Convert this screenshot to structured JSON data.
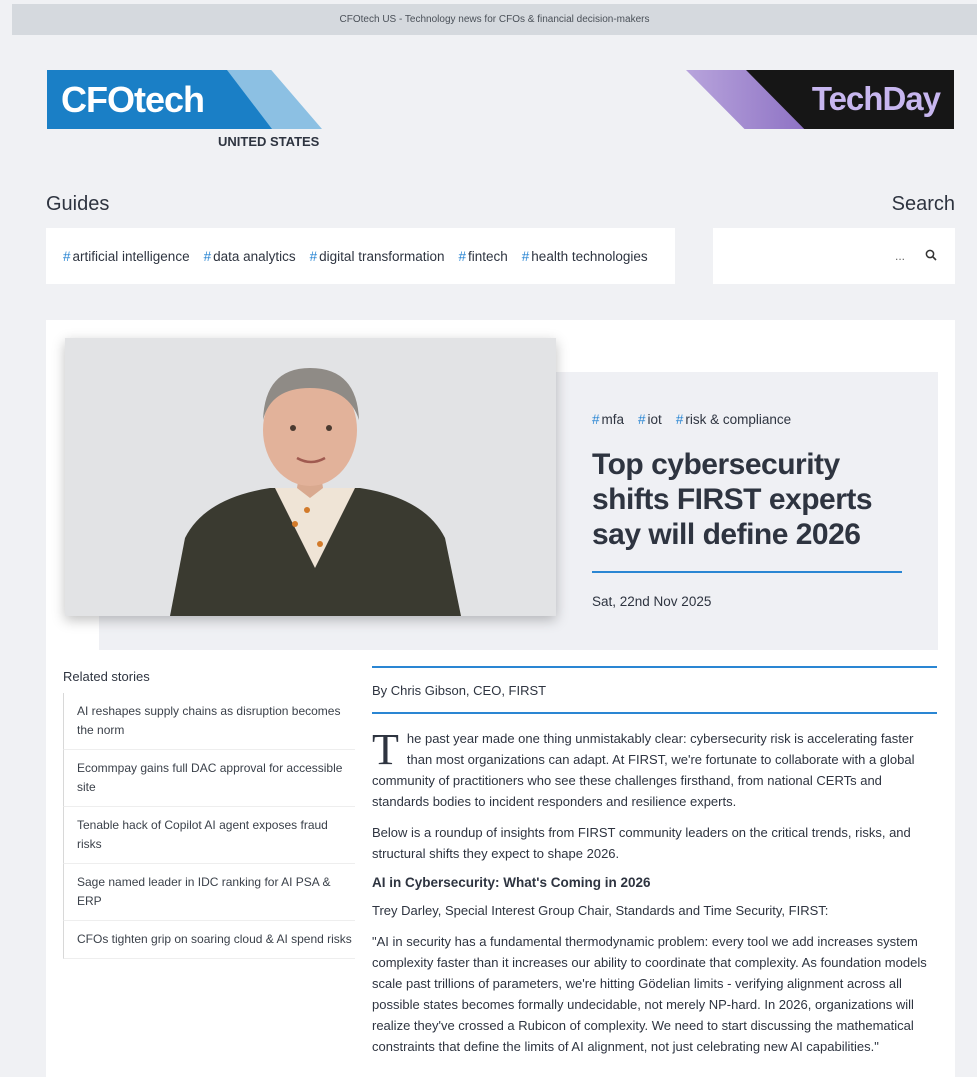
{
  "topbar": {
    "text": "CFOtech US - Technology news for CFOs & financial decision-makers"
  },
  "brand": {
    "wordmark": "CFOtech",
    "region": "UNITED STATES",
    "partner": "TechDay",
    "colors": {
      "blue": "#1a7fc6",
      "light_blue": "#8cc0e3",
      "accent": "#2a86d3",
      "purple": "#8a6ec2"
    }
  },
  "guides": {
    "title": "Guides",
    "tags": [
      {
        "label": "artificial intelligence"
      },
      {
        "label": "data analytics"
      },
      {
        "label": "digital transformation"
      },
      {
        "label": "fintech"
      },
      {
        "label": "health technologies"
      }
    ]
  },
  "search": {
    "title": "Search",
    "placeholder": "...",
    "icon": "search-icon"
  },
  "hero": {
    "tags": [
      {
        "label": "mfa"
      },
      {
        "label": "iot"
      },
      {
        "label": "risk & compliance"
      }
    ],
    "headline": "Top cybersecurity shifts FIRST experts say will define 2026",
    "date": "Sat, 22nd Nov 2025"
  },
  "related": {
    "title": "Related stories",
    "items": [
      {
        "title": "AI reshapes supply chains as disruption becomes the norm"
      },
      {
        "title": "Ecommpay gains full DAC approval for accessible site"
      },
      {
        "title": "Tenable hack of Copilot AI agent exposes fraud risks"
      },
      {
        "title": "Sage named leader in IDC ranking for AI PSA & ERP"
      },
      {
        "title": "CFOs tighten grip on soaring cloud & AI spend risks"
      }
    ]
  },
  "article": {
    "byline": "By Chris Gibson, CEO, FIRST",
    "dropcap": "T",
    "p1": "he past year made one thing unmistakably clear: cybersecurity risk is accelerating faster than most organizations can adapt. At FIRST, we're fortunate to collaborate with a global community of practitioners who see these challenges firsthand, from national CERTs and standards bodies to incident responders and resilience experts.",
    "p2": "Below is a roundup of insights from FIRST community leaders on the critical trends, risks, and structural shifts they expect to shape 2026.",
    "section": "AI in Cybersecurity: What's Coming in 2026",
    "speaker": "Trey Darley, Special Interest Group Chair, Standards and Time Security, FIRST:",
    "quote": "\"AI in security has a fundamental thermodynamic problem: every tool we add increases system complexity faster than it increases our ability to coordinate that complexity. As foundation models scale past trillions of parameters, we're hitting Gödelian limits - verifying alignment across all possible states becomes formally undecidable, not merely NP-hard. In 2026, organizations will realize they've crossed a Rubicon of complexity. We need to start discussing the mathematical constraints that define the limits of AI alignment, not just celebrating new AI capabilities.\""
  }
}
